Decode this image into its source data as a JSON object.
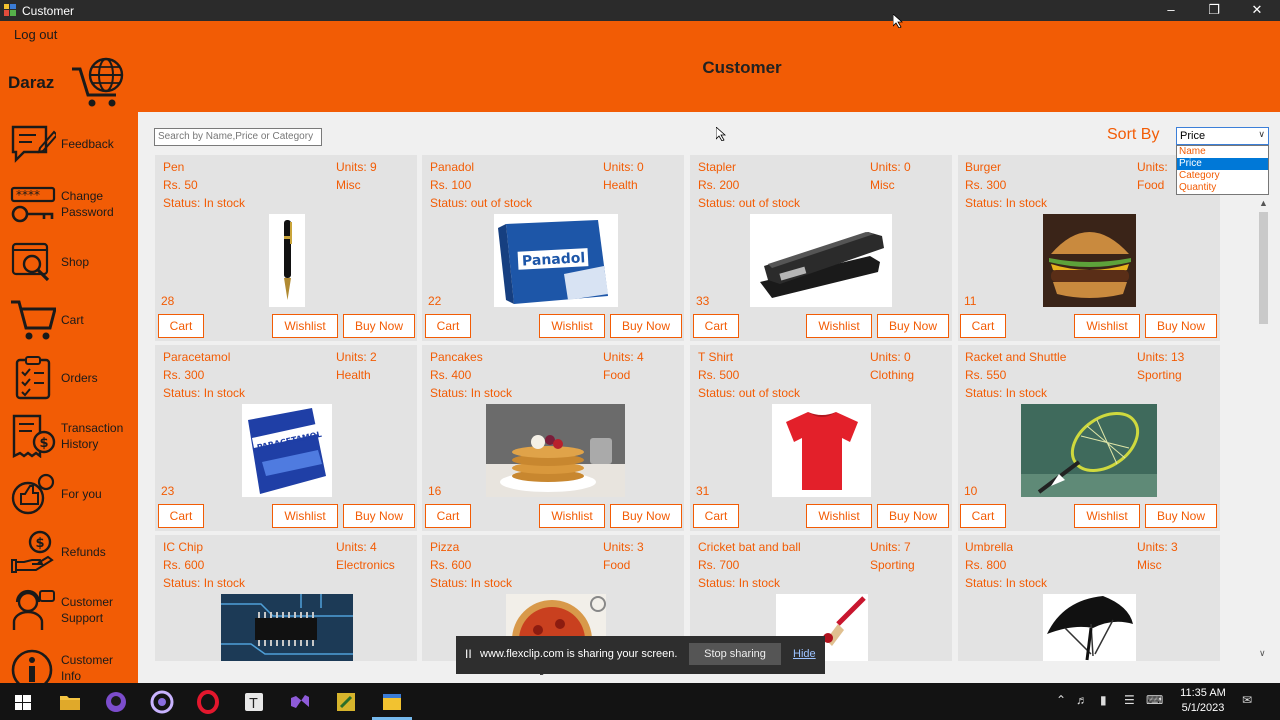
{
  "window": {
    "title": "Customer",
    "minimize": "–",
    "restore": "❐",
    "close": "✕"
  },
  "header": {
    "logout": "Log out",
    "brand": "Daraz",
    "title": "Customer"
  },
  "sidebar": {
    "feedback": [
      "Feedback"
    ],
    "password": [
      "Change",
      "Password"
    ],
    "shop": [
      "Shop"
    ],
    "cart": [
      "Cart"
    ],
    "orders": [
      "Orders"
    ],
    "history": [
      "Transaction",
      "History"
    ],
    "foryou": [
      "For you"
    ],
    "refunds": [
      "Refunds"
    ],
    "support": [
      "Customer",
      "Support"
    ],
    "info": [
      "Customer",
      "Info"
    ]
  },
  "search": {
    "placeholder": "Search by Name,Price or Category"
  },
  "sort": {
    "label": "Sort By",
    "selected": "Price",
    "options": [
      "Name",
      "Price",
      "Category",
      "Quantity"
    ]
  },
  "buttons": {
    "cart": "Cart",
    "wishlist": "Wishlist",
    "buy": "Buy Now"
  },
  "products": [
    {
      "name": "Pen",
      "price": "Rs. 50",
      "units": "Units:  9",
      "category": "Misc",
      "status": "Status: In stock",
      "id": "28"
    },
    {
      "name": "Panadol",
      "price": "Rs. 100",
      "units": "Units:  0",
      "category": "Health",
      "status": "Status: out of stock",
      "id": "22"
    },
    {
      "name": "Stapler",
      "price": "Rs. 200",
      "units": "Units:  0",
      "category": "Misc",
      "status": "Status: out of stock",
      "id": "33"
    },
    {
      "name": "Burger",
      "price": "Rs. 300",
      "units": "Units:",
      "category": "Food",
      "status": "Status: In stock",
      "id": "11"
    },
    {
      "name": "Paracetamol",
      "price": "Rs. 300",
      "units": "Units:  2",
      "category": "Health",
      "status": "Status: In stock",
      "id": "23"
    },
    {
      "name": "Pancakes",
      "price": "Rs. 400",
      "units": "Units:  4",
      "category": "Food",
      "status": "Status: In stock",
      "id": "16"
    },
    {
      "name": "T Shirt",
      "price": "Rs. 500",
      "units": "Units:  0",
      "category": "Clothing",
      "status": "Status: out of stock",
      "id": "31"
    },
    {
      "name": "Racket and Shuttle",
      "price": "Rs. 550",
      "units": "Units:  13",
      "category": "Sporting",
      "status": "Status: In stock",
      "id": "10"
    },
    {
      "name": "IC Chip",
      "price": "Rs. 600",
      "units": "Units:  4",
      "category": "Electronics",
      "status": "Status: In stock",
      "id": ""
    },
    {
      "name": "Pizza",
      "price": "Rs. 600",
      "units": "Units:  3",
      "category": "Food",
      "status": "Status: In stock",
      "id": ""
    },
    {
      "name": "Cricket bat and ball",
      "price": "Rs. 700",
      "units": "Units:  7",
      "category": "Sporting",
      "status": "Status: In stock",
      "id": ""
    },
    {
      "name": "Umbrella",
      "price": "Rs. 800",
      "units": "Units:  3",
      "category": "Misc",
      "status": "Status: In stock",
      "id": ""
    }
  ],
  "share_bar": {
    "pause": "II",
    "message": "www.flexclip.com is sharing your screen.",
    "stop": "Stop sharing",
    "hide": "Hide"
  },
  "taskbar": {
    "time": "11:35 AM",
    "date": "5/1/2023"
  },
  "colors": {
    "accent": "#f25c05",
    "card": "#e3e3e3",
    "taskbar": "#131313"
  }
}
